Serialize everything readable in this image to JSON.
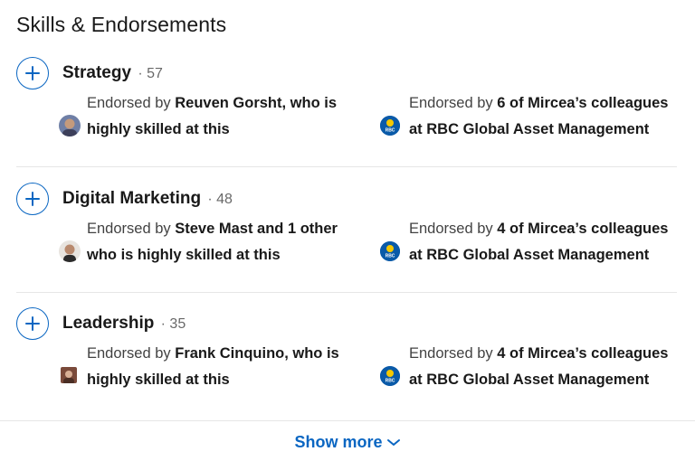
{
  "section": {
    "title": "Skills & Endorsements"
  },
  "skills": [
    {
      "name": "Strategy",
      "count": "· 57",
      "left": {
        "prefix": "Endorsed by ",
        "bold1": "Reuven Gorsht, who is",
        "line2": "highly skilled at this"
      },
      "right": {
        "prefix": "Endorsed by ",
        "bold1": "6 of Mircea’s colleagues",
        "line2": "at RBC Global Asset Management"
      }
    },
    {
      "name": "Digital Marketing",
      "count": "· 48",
      "left": {
        "prefix": "Endorsed by ",
        "bold1": "Steve Mast and 1 other",
        "line2": "who is highly skilled at this"
      },
      "right": {
        "prefix": "Endorsed by ",
        "bold1": "4 of Mircea’s colleagues",
        "line2": "at RBC Global Asset Management"
      }
    },
    {
      "name": "Leadership",
      "count": "· 35",
      "left": {
        "prefix": "Endorsed by ",
        "bold1": "Frank Cinquino, who is",
        "line2": "highly skilled at this"
      },
      "right": {
        "prefix": "Endorsed by ",
        "bold1": "4 of Mircea’s colleagues",
        "line2": "at RBC Global Asset Management"
      }
    }
  ],
  "footer": {
    "show_more": "Show more"
  },
  "colors": {
    "accent": "#0a66c2",
    "rbc_blue": "#0a5aa8",
    "rbc_yellow": "#f5c800"
  },
  "icons": {
    "endorse": "plus-icon",
    "expand": "chevron-down-icon",
    "company": "rbc-logo-icon"
  }
}
